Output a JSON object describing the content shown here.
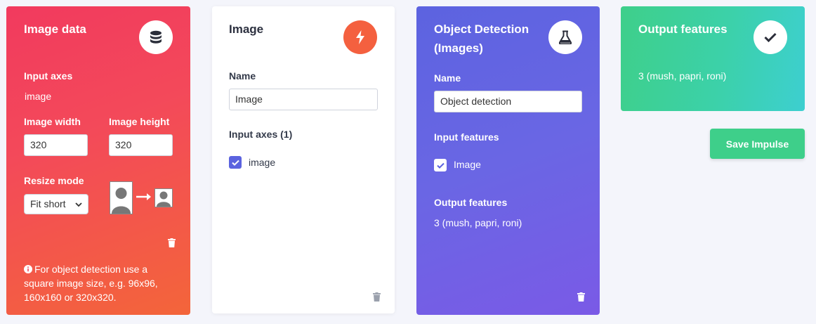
{
  "image_data_block": {
    "title": "Image data",
    "icon": "database-icon",
    "input_axes_label": "Input axes",
    "input_axes_value": "image",
    "image_width_label": "Image width",
    "image_width_value": "320",
    "image_height_label": "Image height",
    "image_height_value": "320",
    "resize_mode_label": "Resize mode",
    "resize_mode_value": "Fit short",
    "info_text": "For object detection use a square image size, e.g. 96x96, 160x160 or 320x320."
  },
  "processing_block": {
    "title": "Image",
    "icon": "bolt-icon",
    "name_label": "Name",
    "name_value": "Image",
    "input_axes_label": "Input axes (1)",
    "axis_item": "image"
  },
  "learning_block": {
    "title": "Object Detection (Images)",
    "icon": "flask-icon",
    "name_label": "Name",
    "name_value": "Object detection",
    "input_features_label": "Input features",
    "input_feature_item": "Image",
    "output_features_label": "Output features",
    "output_features_value": "3 (mush, papri, roni)"
  },
  "output_block": {
    "title": "Output features",
    "icon": "check-icon",
    "value": "3 (mush, papri, roni)"
  },
  "save_button_label": "Save Impulse",
  "colors": {
    "image_data": "#f23a5e",
    "learning": "#6366e2",
    "output": "#3ecf8a",
    "bolt_accent": "#f4603f",
    "checkbox_blue": "#5b63df"
  }
}
